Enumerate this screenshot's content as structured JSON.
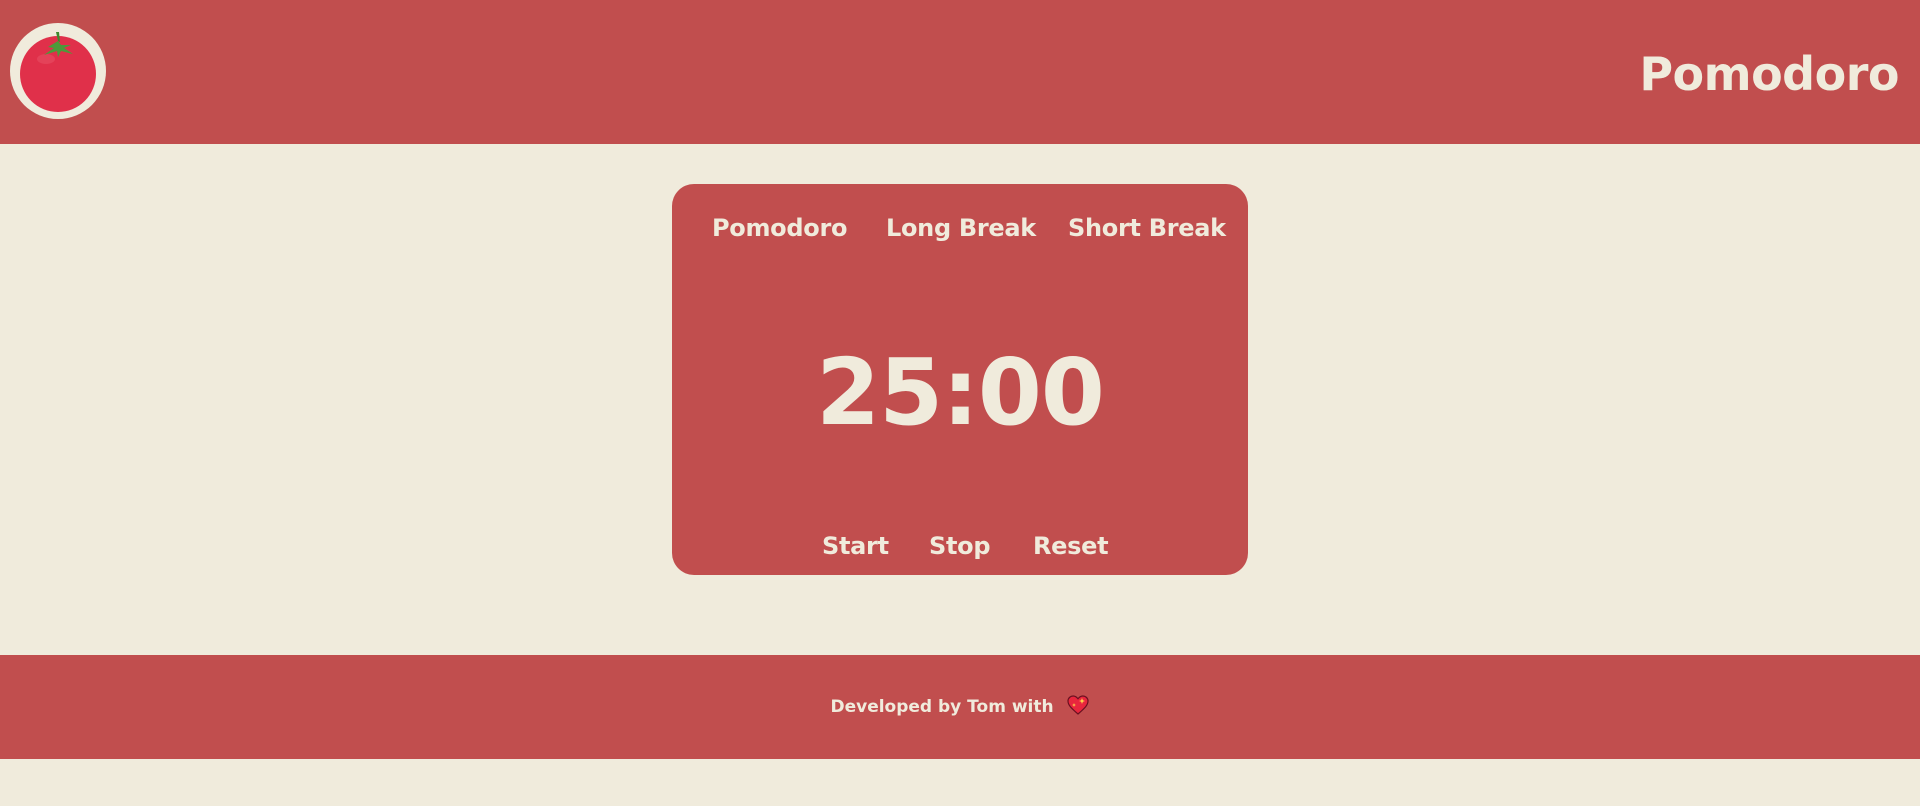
{
  "header": {
    "title": "Pomodoro",
    "logo_icon": "tomato-icon"
  },
  "timer": {
    "tabs": [
      {
        "label": "Pomodoro"
      },
      {
        "label": "Long Break"
      },
      {
        "label": "Short Break"
      }
    ],
    "time": "25:00",
    "controls": {
      "start_label": "Start",
      "stop_label": "Stop",
      "reset_label": "Reset"
    }
  },
  "footer": {
    "text": "Developed by Tom with",
    "icon": "sparkling-heart-icon"
  },
  "colors": {
    "primary": "#c14e4e",
    "background": "#f0ebdc",
    "text_light": "#f0ebdc"
  }
}
